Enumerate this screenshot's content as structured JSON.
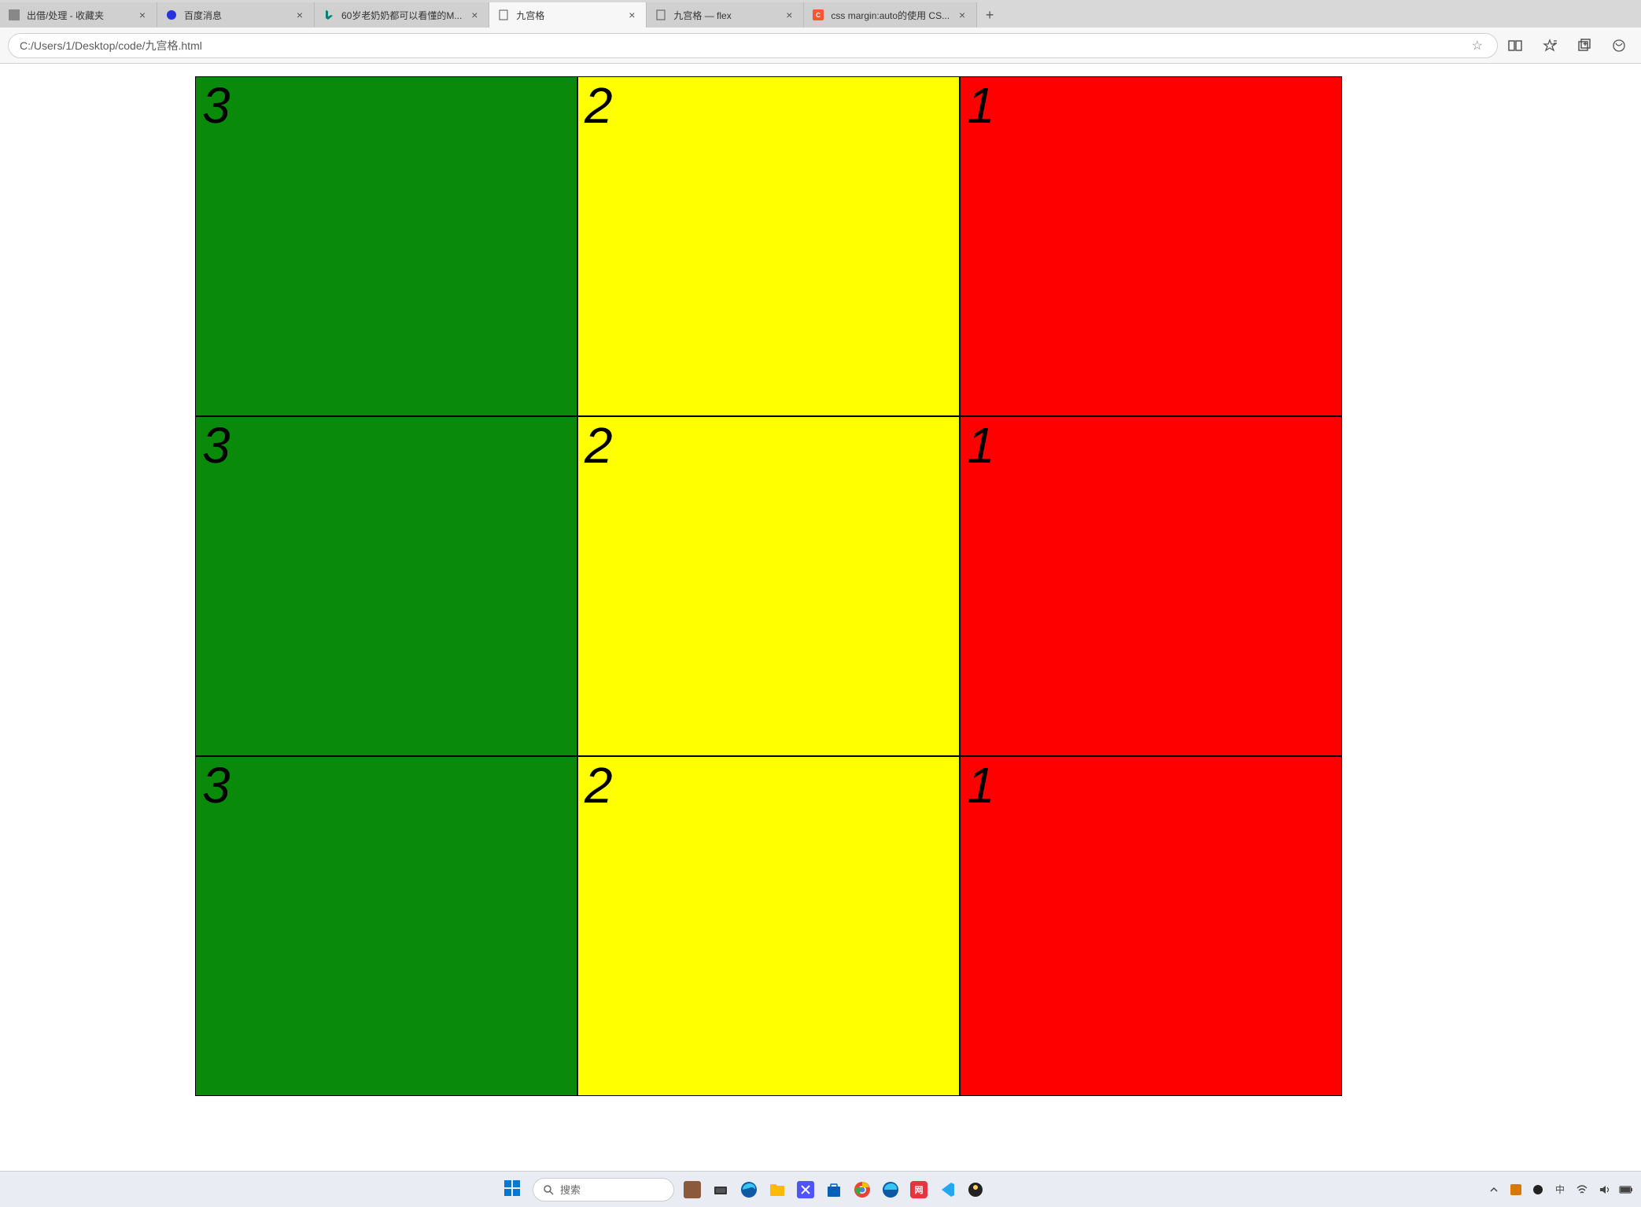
{
  "browser": {
    "tabs": [
      {
        "title": "出借/处理 - 收藏夹",
        "icon": "generic"
      },
      {
        "title": "百度消息",
        "icon": "baidu"
      },
      {
        "title": "60岁老奶奶都可以看懂的M...",
        "icon": "bing"
      },
      {
        "title": "九宫格",
        "icon": "file",
        "active": true
      },
      {
        "title": "九宫格 — flex",
        "icon": "file"
      },
      {
        "title": "css margin:auto的使用 CS...",
        "icon": "csdn"
      }
    ],
    "url": "C:/Users/1/Desktop/code/九宫格.html",
    "search_placeholder": "搜索"
  },
  "grid": {
    "rows": [
      [
        {
          "label": "3",
          "color": "green"
        },
        {
          "label": "2",
          "color": "yellow"
        },
        {
          "label": "1",
          "color": "red"
        }
      ],
      [
        {
          "label": "3",
          "color": "green"
        },
        {
          "label": "2",
          "color": "yellow"
        },
        {
          "label": "1",
          "color": "red"
        }
      ],
      [
        {
          "label": "3",
          "color": "green"
        },
        {
          "label": "2",
          "color": "yellow"
        },
        {
          "label": "1",
          "color": "red"
        }
      ]
    ]
  },
  "colors": {
    "green": "#0a8a0a",
    "yellow": "#ffff00",
    "red": "#ff0000"
  }
}
